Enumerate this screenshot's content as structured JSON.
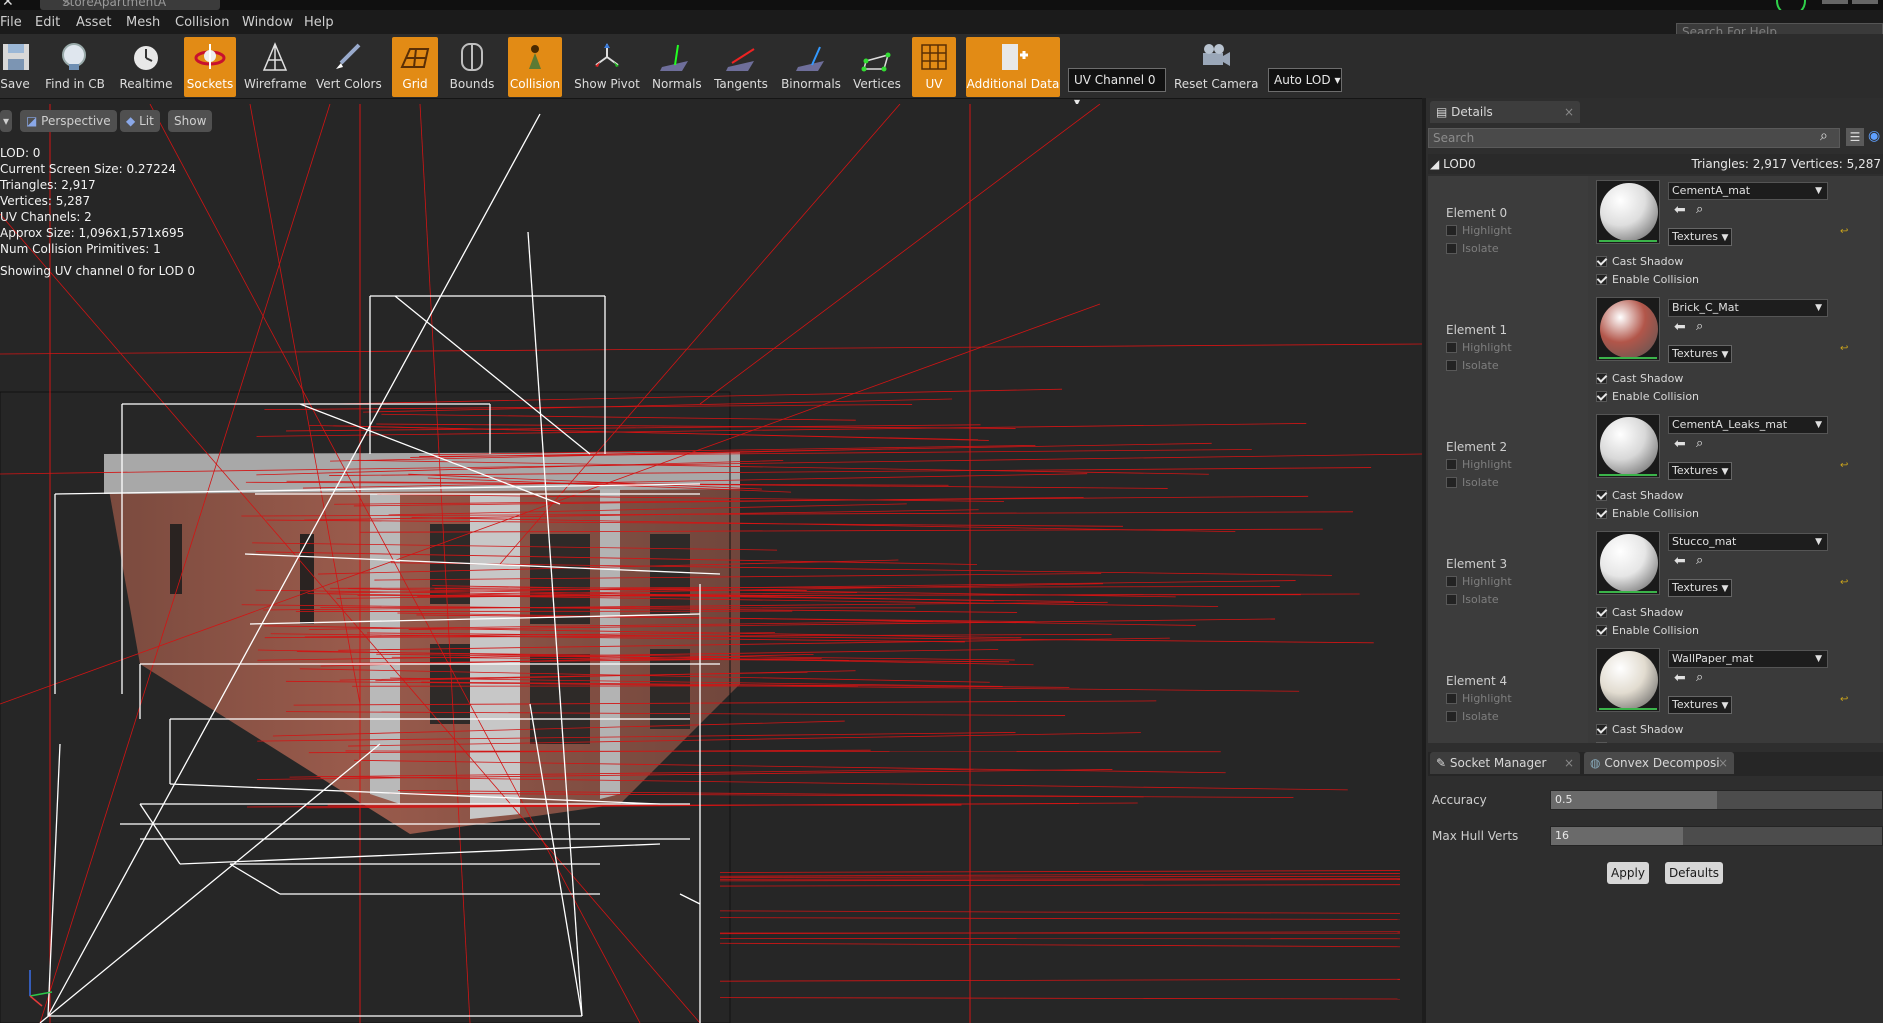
{
  "window": {
    "tab_title": "StoreApartmentA"
  },
  "menu": [
    "File",
    "Edit",
    "Asset",
    "Mesh",
    "Collision",
    "Window",
    "Help"
  ],
  "help_search_placeholder": "Search For Help",
  "toolbar": {
    "buttons": [
      {
        "label": "Save",
        "icon": "save-icon",
        "active": false
      },
      {
        "label": "Find in CB",
        "icon": "find-in-content-browser-icon",
        "active": false
      },
      {
        "label": "Realtime",
        "icon": "realtime-icon",
        "active": false
      },
      {
        "label": "Sockets",
        "icon": "sockets-icon",
        "active": true
      },
      {
        "label": "Wireframe",
        "icon": "wireframe-icon",
        "active": false
      },
      {
        "label": "Vert Colors",
        "icon": "vert-colors-icon",
        "active": false
      },
      {
        "label": "Grid",
        "icon": "grid-icon",
        "active": true
      },
      {
        "label": "Bounds",
        "icon": "bounds-icon",
        "active": false
      },
      {
        "label": "Collision",
        "icon": "collision-icon",
        "active": true
      },
      {
        "label": "Show Pivot",
        "icon": "pivot-icon",
        "active": false
      },
      {
        "label": "Normals",
        "icon": "normals-icon",
        "active": false
      },
      {
        "label": "Tangents",
        "icon": "tangents-icon",
        "active": false
      },
      {
        "label": "Binormals",
        "icon": "binormals-icon",
        "active": false
      },
      {
        "label": "Vertices",
        "icon": "vertices-icon",
        "active": false
      },
      {
        "label": "UV",
        "icon": "uv-icon",
        "active": true
      },
      {
        "label": "Additional Data",
        "icon": "additional-data-icon",
        "active": true
      },
      {
        "label": "Reset Camera",
        "icon": "reset-camera-icon",
        "active": false
      }
    ],
    "uv_channel": "UV Channel 0",
    "lod": "Auto LOD"
  },
  "viewport": {
    "perspective": "Perspective",
    "lit": "Lit",
    "show": "Show",
    "stats": [
      "LOD:  0",
      "Current Screen Size:  0.27224",
      "Triangles:  2,917",
      "Vertices:  5,287",
      "UV Channels:  2",
      "Approx Size: 1,096x1,571x695",
      "Num Collision Primitives:  1"
    ],
    "uv_info": "Showing UV channel 0 for LOD 0"
  },
  "details": {
    "tab": "Details",
    "search_placeholder": "Search",
    "lod_title": "LOD0",
    "lod_stats": "Triangles: 2,917    Vertices: 5,287",
    "highlight_label": "Highlight",
    "isolate_label": "Isolate",
    "cast_shadow_label": "Cast Shadow",
    "enable_collision_label": "Enable Collision",
    "textures_label": "Textures",
    "elements": [
      {
        "title": "Element 0",
        "material": "CementA_mat",
        "color": "#dedede"
      },
      {
        "title": "Element 1",
        "material": "Brick_C_Mat",
        "color": "#b2564a"
      },
      {
        "title": "Element 2",
        "material": "CementA_Leaks_mat",
        "color": "#d8d8d8"
      },
      {
        "title": "Element 3",
        "material": "Stucco_mat",
        "color": "#e6e6e6"
      },
      {
        "title": "Element 4",
        "material": "WallPaper_mat",
        "color": "#e2dcd0"
      }
    ]
  },
  "socket_manager_tab": "Socket Manager",
  "convex_tab": "Convex Decomposi",
  "convex": {
    "accuracy_label": "Accuracy",
    "accuracy_value": "0.5",
    "accuracy_fraction": 0.5,
    "max_hull_label": "Max Hull Verts",
    "max_hull_value": "16",
    "max_hull_fraction": 0.4,
    "apply": "Apply",
    "defaults": "Defaults"
  },
  "colors": {
    "accent": "#e28b15",
    "collision_red": "#d21414",
    "wire_white": "#ffffff"
  }
}
